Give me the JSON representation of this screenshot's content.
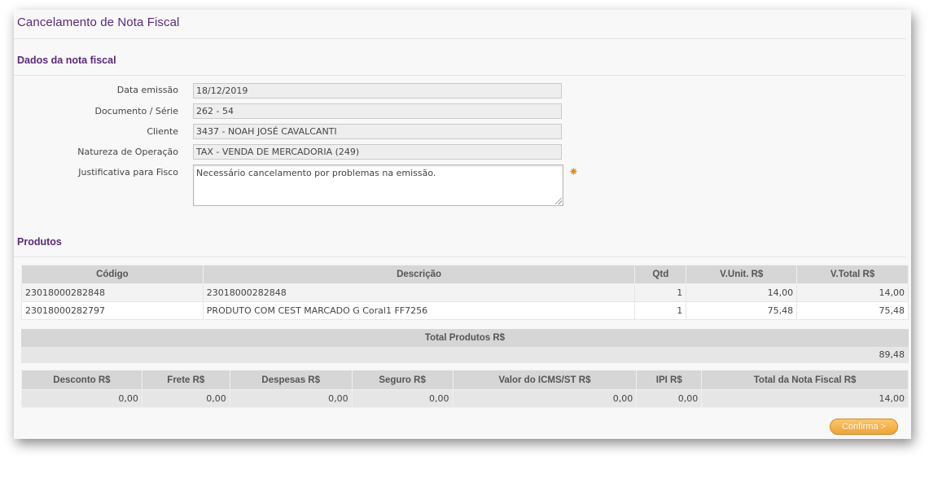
{
  "page": {
    "title": "Cancelamento de Nota Fiscal"
  },
  "invoice_section": {
    "title": "Dados da nota fiscal",
    "fields": [
      {
        "label": "Data emissão",
        "value": "18/12/2019"
      },
      {
        "label": "Documento / Série",
        "value": "262 - 54"
      },
      {
        "label": "Cliente",
        "value": "3437 - NOAH JOSÉ CAVALCANTI"
      },
      {
        "label": "Natureza de Operação",
        "value": "TAX - VENDA DE MERCADORIA (249)"
      }
    ],
    "justification": {
      "label": "Justificativa para Fisco",
      "value": "Necessário cancelamento por problemas na emissão."
    }
  },
  "products": {
    "title": "Produtos",
    "columns": [
      "Código",
      "Descrição",
      "Qtd",
      "V.Unit. R$",
      "V.Total R$"
    ],
    "rows": [
      [
        "23018000282848",
        "23018000282848",
        "1",
        "14,00",
        "14,00"
      ],
      [
        "23018000282797",
        "PRODUTO COM CEST MARCADO G Coral1 FF7256",
        "1",
        "75,48",
        "75,48"
      ]
    ]
  },
  "total_products": {
    "label": "Total Produtos R$",
    "value": "89,48"
  },
  "summary": {
    "columns": [
      "Desconto R$",
      "Frete R$",
      "Despesas R$",
      "Seguro R$",
      "Valor do ICMS/ST R$",
      "IPI R$",
      "Total da Nota Fiscal R$"
    ],
    "values": [
      "0,00",
      "0,00",
      "0,00",
      "0,00",
      "0,00",
      "0,00",
      "14,00"
    ]
  },
  "actions": {
    "confirm_label": "Confirma >"
  },
  "colors": {
    "heading": "#5a2a7a",
    "button": "#f0a236",
    "required_marker": "#e08a1a"
  }
}
